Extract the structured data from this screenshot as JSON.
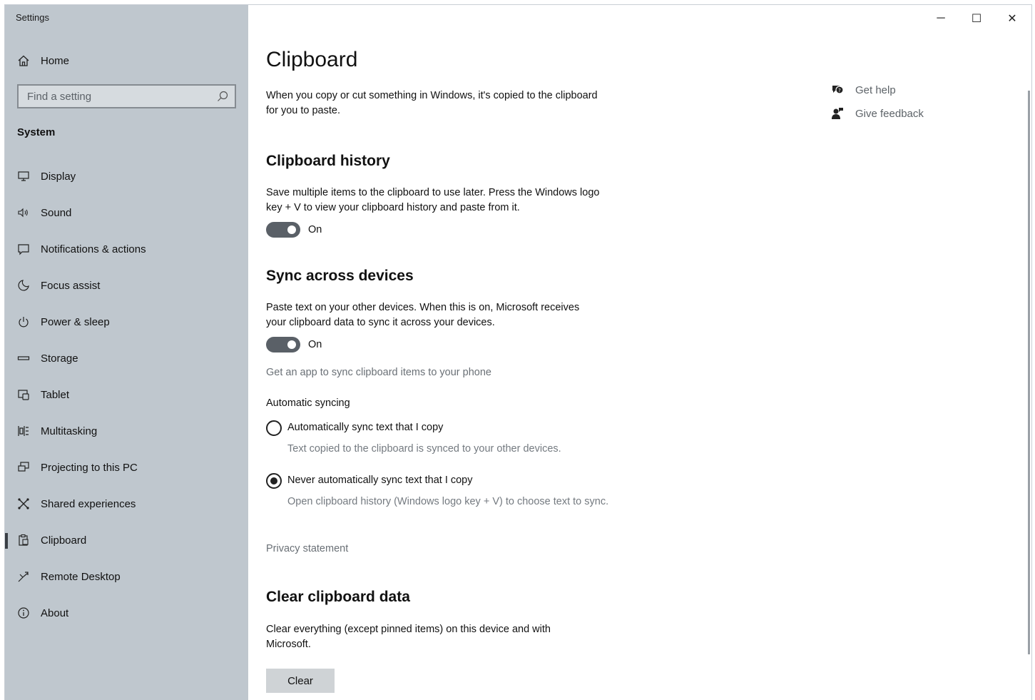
{
  "window": {
    "title": "Settings",
    "controls": {
      "minimize": "─",
      "maximize": "☐",
      "close": "✕"
    }
  },
  "sidebar": {
    "home_label": "Home",
    "search": {
      "placeholder": "Find a setting"
    },
    "section_title": "System",
    "items": [
      {
        "label": "Display",
        "icon": "display-icon"
      },
      {
        "label": "Sound",
        "icon": "sound-icon"
      },
      {
        "label": "Notifications & actions",
        "icon": "notifications-icon"
      },
      {
        "label": "Focus assist",
        "icon": "focus-assist-icon"
      },
      {
        "label": "Power & sleep",
        "icon": "power-icon"
      },
      {
        "label": "Storage",
        "icon": "storage-icon"
      },
      {
        "label": "Tablet",
        "icon": "tablet-icon"
      },
      {
        "label": "Multitasking",
        "icon": "multitasking-icon"
      },
      {
        "label": "Projecting to this PC",
        "icon": "projecting-icon"
      },
      {
        "label": "Shared experiences",
        "icon": "shared-experiences-icon"
      },
      {
        "label": "Clipboard",
        "icon": "clipboard-icon",
        "selected": true
      },
      {
        "label": "Remote Desktop",
        "icon": "remote-desktop-icon"
      },
      {
        "label": "About",
        "icon": "about-icon"
      }
    ]
  },
  "main": {
    "title": "Clipboard",
    "intro": "When you copy or cut something in Windows, it's copied to the clipboard for you to paste.",
    "help": {
      "get_help": "Get help",
      "give_feedback": "Give feedback"
    },
    "history": {
      "heading": "Clipboard history",
      "description": "Save multiple items to the clipboard to use later. Press the Windows logo key + V to view your clipboard history and paste from it.",
      "toggle_label": "On",
      "toggle_on": true
    },
    "sync": {
      "heading": "Sync across devices",
      "description": "Paste text on your other devices. When this is on, Microsoft receives your clipboard data to sync it across your devices.",
      "toggle_label": "On",
      "toggle_on": true,
      "app_link": "Get an app to sync clipboard items to your phone",
      "auto_heading": "Automatic syncing",
      "options": [
        {
          "label": "Automatically sync text that I copy",
          "description": "Text copied to the clipboard is synced to your other devices.",
          "checked": false
        },
        {
          "label": "Never automatically sync text that I copy",
          "description": "Open clipboard history (Windows logo key + V) to choose text to sync.",
          "checked": true
        }
      ],
      "privacy_link": "Privacy statement"
    },
    "clear": {
      "heading": "Clear clipboard data",
      "description": "Clear everything (except pinned items) on this device and with Microsoft.",
      "button_label": "Clear"
    }
  }
}
